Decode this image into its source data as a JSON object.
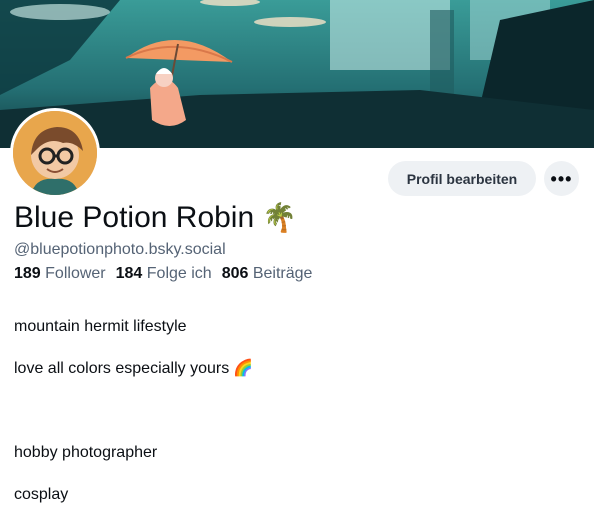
{
  "banner": {
    "alt": "Profile banner illustration"
  },
  "profile": {
    "display_name": "Blue Potion Robin",
    "display_emoji": "🌴",
    "handle": "@bluepotionphoto.bsky.social",
    "stats": {
      "followers_count": "189",
      "followers_label": "Follower",
      "following_count": "184",
      "following_label": "Folge ich",
      "posts_count": "806",
      "posts_label": "Beiträge"
    },
    "bio": [
      "mountain hermit lifestyle",
      "love all colors especially yours",
      "",
      "hobby photographer",
      "cosplay"
    ],
    "bio_emoji": "🌈"
  },
  "actions": {
    "edit_profile_label": "Profil bearbeiten",
    "more_label": "•••"
  }
}
